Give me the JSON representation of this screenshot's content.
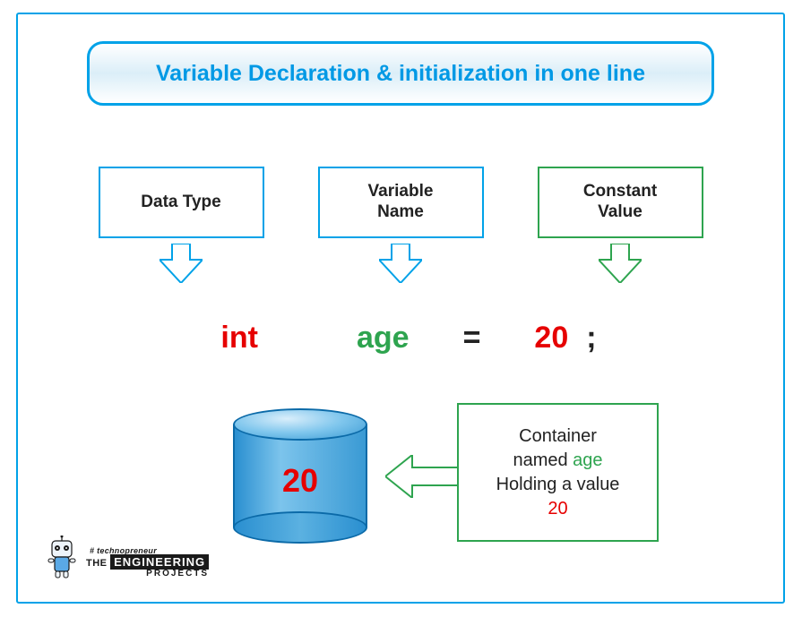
{
  "title": "Variable Declaration & initialization in one line",
  "callouts": {
    "datatype": "Data Type",
    "varname": "Variable\nName",
    "constval": "Constant\nValue"
  },
  "code": {
    "keyword": "int",
    "identifier": "age",
    "operator": "=",
    "value": "20",
    "semicolon": ";"
  },
  "container": {
    "stored_value": "20"
  },
  "explain": {
    "line1": "Container",
    "line2a": "named ",
    "line2b_age": "age",
    "line3": "Holding a value",
    "line4_val": "20"
  },
  "logo": {
    "tag": "# technopreneur",
    "the": "THE ",
    "eng": "ENGINEERING",
    "proj": "PROJECTS"
  },
  "colors": {
    "blue": "#00a2e8",
    "green": "#2ea44f",
    "red": "#e60000"
  }
}
